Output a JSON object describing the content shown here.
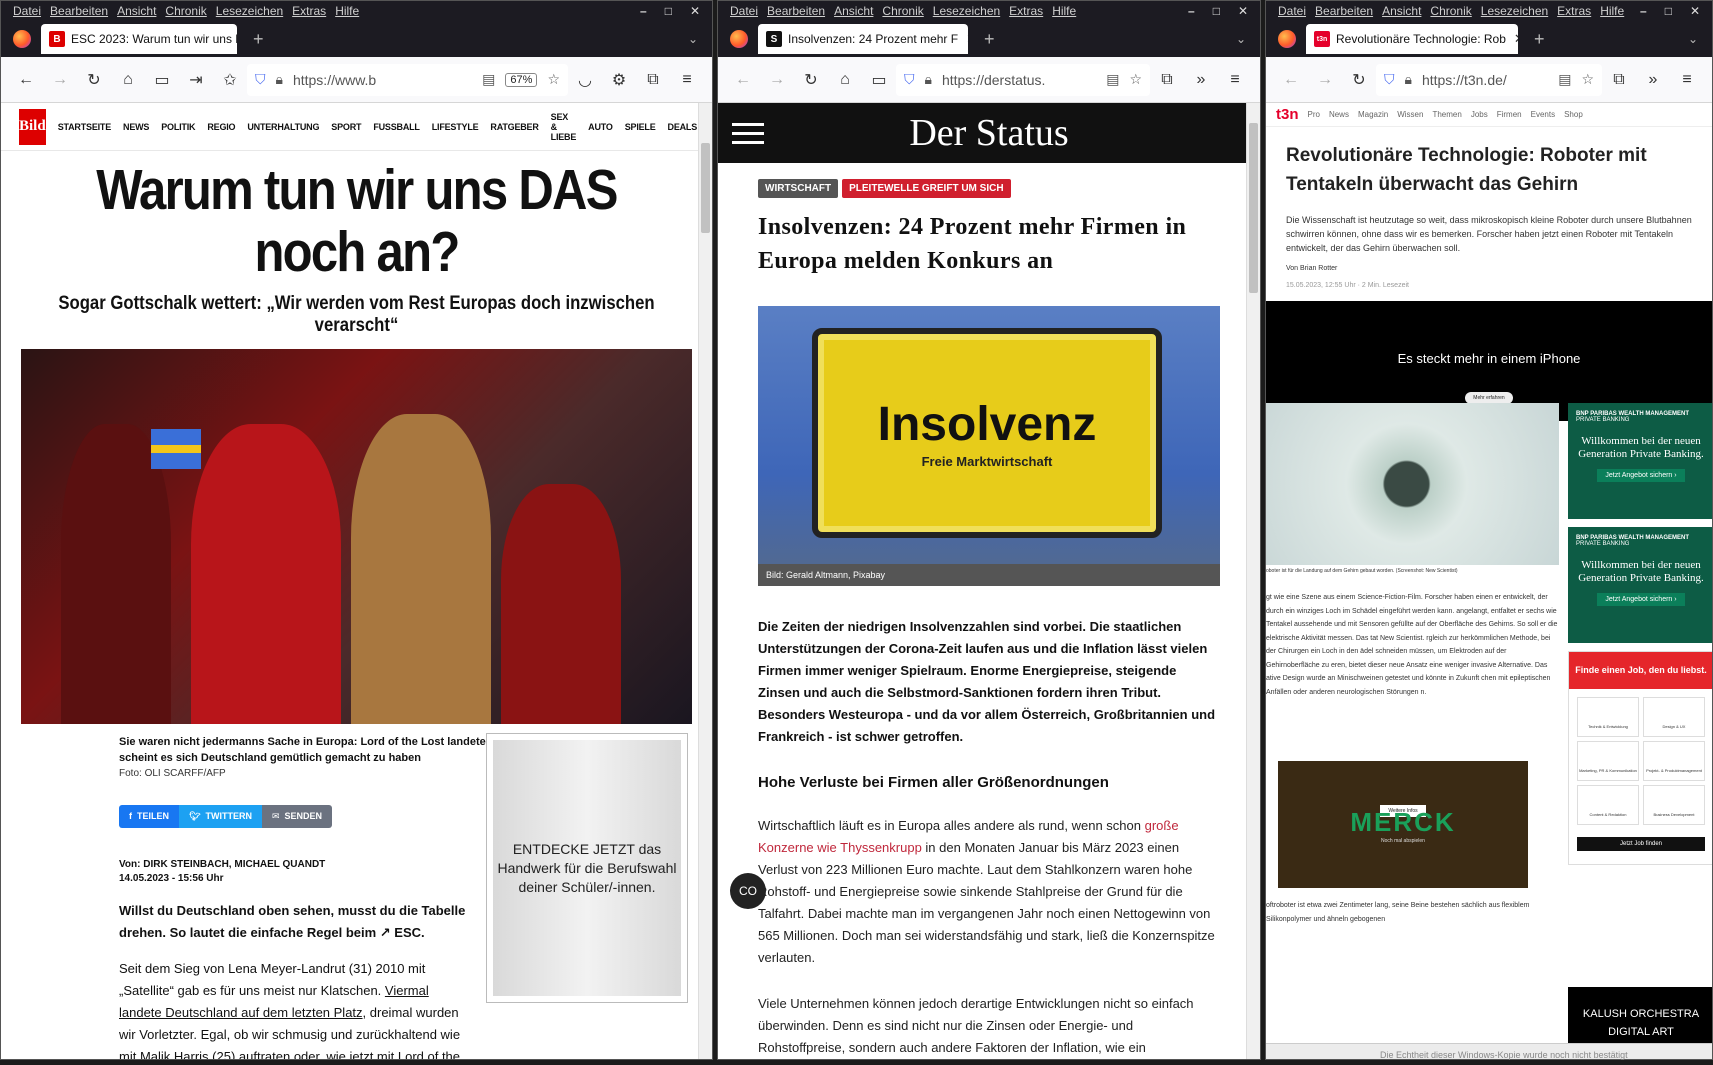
{
  "menu": [
    "Datei",
    "Bearbeiten",
    "Ansicht",
    "Chronik",
    "Lesezeichen",
    "Extras",
    "Hilfe"
  ],
  "window_controls": [
    "–",
    "□",
    "✕"
  ],
  "w1": {
    "tab_title": "ESC 2023: Warum tun wir uns D",
    "favicon": "Bild",
    "url": "https://www.b",
    "zoom": "67%",
    "nav_items": [
      "STARTSEITE",
      "NEWS",
      "POLITIK",
      "REGIO",
      "UNTERHALTUNG",
      "SPORT",
      "FUSSBALL",
      "LIFESTYLE",
      "RATGEBER",
      "SEX & LIEBE",
      "AUTO",
      "SPIELE",
      "DEALS"
    ],
    "logo": "Bild",
    "headline": "Warum tun wir uns DAS noch an?",
    "subheadline": "Sogar Gottschalk wettert: „Wir werden vom Rest Europas doch inzwischen verarscht“",
    "caption": "Sie waren nicht jedermanns Sache in Europa: Lord of the Lost landeten auf dem letzten ESC-Platz. Dort scheint es sich Deutschland gemütlich gemacht zu haben",
    "photo_credit": "Foto: OLI SCARFF/AFP",
    "share": [
      "TEILEN",
      "TWITTERN",
      "SENDEN"
    ],
    "authors": "Von: DIRK STEINBACH, MICHAEL QUANDT",
    "date": "14.05.2023 - 15:56 Uhr",
    "lead": "Willst du Deutschland oben sehen, musst du die Tabelle drehen. So lautet die einfache Regel beim ↗ ESC.",
    "p1a": "Seit dem Sieg von Lena Meyer-Landrut (31) 2010 mit „Satellite“ gab es für uns meist nur Klatschen. ",
    "p1link": "Viermal landete Deutschland auf dem letzten Platz",
    "p1b": ", dreimal wurden wir Vorletzter. Egal, ob wir schmusig und zurückhaltend wie mit Malik Harris (25) auftraten oder, wie jetzt mit Lord of the Lost, selbstbewusst rockig.",
    "ad": "ENTDECKE JETZT das Handwerk für die Berufswahl deiner Schüler/-innen."
  },
  "w2": {
    "tab_title": "Insolvenzen: 24 Prozent mehr F",
    "favicon": "S",
    "url": "https://derstatus.",
    "logo": "Der Status",
    "tags": [
      "WIRTSCHAFT",
      "PLEITEWELLE GREIFT UM SICH"
    ],
    "headline": "Insolvenzen: 24 Prozent mehr Firmen in Europa melden Konkurs an",
    "sign_main": "Insolvenz",
    "sign_sub": "Freie Marktwirtschaft",
    "image_caption": "Bild: Gerald Altmann, Pixabay",
    "lead": "Die Zeiten der niedrigen Insolvenzzahlen sind vorbei. Die staatlichen Unterstützungen der Corona-Zeit laufen aus und die Inflation lässt vielen Firmen immer weniger Spielraum. Enorme Energiepreise, steigende Zinsen und auch die Selbstmord-Sanktionen fordern ihren Tribut. Besonders Westeuropa - und da vor allem Österreich, Großbritannien und Frankreich - ist schwer getroffen.",
    "h2": "Hohe Verluste bei Firmen aller Größenordnungen",
    "p1a": "Wirtschaftlich läuft es in Europa alles andere als rund, wenn schon ",
    "p1link": "große Konzerne wie Thyssenkrupp",
    "p1b": " in den Monaten Januar bis März 2023 einen Verlust von 223 Millionen Euro machte. Laut dem Stahlkonzern waren hohe Rohstoff- und Energiepreise sowie sinkende Stahlpreise der Grund für die Talfahrt. Dabei machte man im vergangenen Jahr noch einen Nettogewinn von 565 Millionen. Doch man sei widerstandsfähig und stark, ließ die Konzernspitze verlauten.",
    "p2": "Viele Unternehmen können jedoch derartige Entwicklungen nicht so einfach überwinden. Denn es sind nicht nur die Zinsen oder Energie- und Rohstoffpreise, sondern auch andere Faktoren der Inflation, wie ein",
    "fab": "CO"
  },
  "w3": {
    "tab_title": "Revolutionäre Technologie: Rob",
    "favicon": "t3n",
    "url": "https://t3n.de/",
    "logo": "t3n",
    "nav_items": [
      "Pro",
      "News",
      "Magazin",
      "Wissen",
      "Themen",
      "Jobs",
      "Firmen",
      "Events",
      "Shop"
    ],
    "headline": "Revolutionäre Technologie: Roboter mit Tentakeln überwacht das Gehirn",
    "lead": "Die Wissenschaft ist heutzutage so weit, dass mikroskopisch kleine Roboter durch unsere Blutbahnen schwirren können, ohne dass wir es bemerken. Forscher haben jetzt einen Roboter mit Tentakeln entwickelt, der das Gehirn überwachen soll.",
    "byline": "Von Brian Rotter",
    "date": "15.05.2023, 12:55 Uhr · 2 Min. Lesezeit",
    "ad_text": "Es steckt mehr in einem iPhone",
    "ad_button": "Mehr erfahren",
    "img_caption": "oboter ist für die Landung auf dem Gehirn gebaut worden. (Screenshot: New Scientist)",
    "body": "gt wie eine Szene aus einem Science-Fiction-Film. Forscher haben einen er entwickelt, der durch ein winziges Loch im Schädel eingeführt werden kann. angelangt, entfaltet er sechs wie Tentakel aussehende und mit Sensoren gefüllte auf der Oberfläche des Gehirns. So soll er die elektrische Aktivität messen. Das tat New Scientist. rgleich zur herkömmlichen Methode, bei der Chirurgen ein Loch in den ädel schneiden müssen, um Elektroden auf der Gehirnoberfläche zu eren, bietet dieser neue Ansatz eine weniger invasive Alternative. Das ative Design wurde an Minischweinen getestet und könnte in Zukunft chen mit epileptischen Anfällen oder anderen neurologischen Störungen n.",
    "merck": "MERCK",
    "merck_btn": "Weitere Infos",
    "merck_sub": "Noch mal abspielen",
    "tail": "oftroboter ist etwa zwei Zentimeter lang, seine Beine bestehen sächlich aus flexiblem Silikonpolymer und ähneln gebogenen",
    "bnp_brand": "BNP PARIBAS WEALTH MANAGEMENT",
    "bnp_sub": "PRIVATE BANKING",
    "bnp_text": "Willkommen bei der neuen Generation Private Banking.",
    "bnp_btn": "Jetzt Angebot sichern  ›",
    "job_title": "Finde einen Job, den du liebst.",
    "job_cats": [
      "Technik & Entwicklung",
      "Design & UX",
      "Marketing, PR & Kommunikation",
      "Projekt- & Produktmanagement",
      "Content & Redaktion",
      "Business Development"
    ],
    "job_btn": "Jetzt Job finden",
    "kalush": "KALUSH ORCHESTRA DIGITAL ART"
  },
  "taskbar_note": "Die Echtheit dieser Windows-Kopie wurde noch nicht bestätigt"
}
